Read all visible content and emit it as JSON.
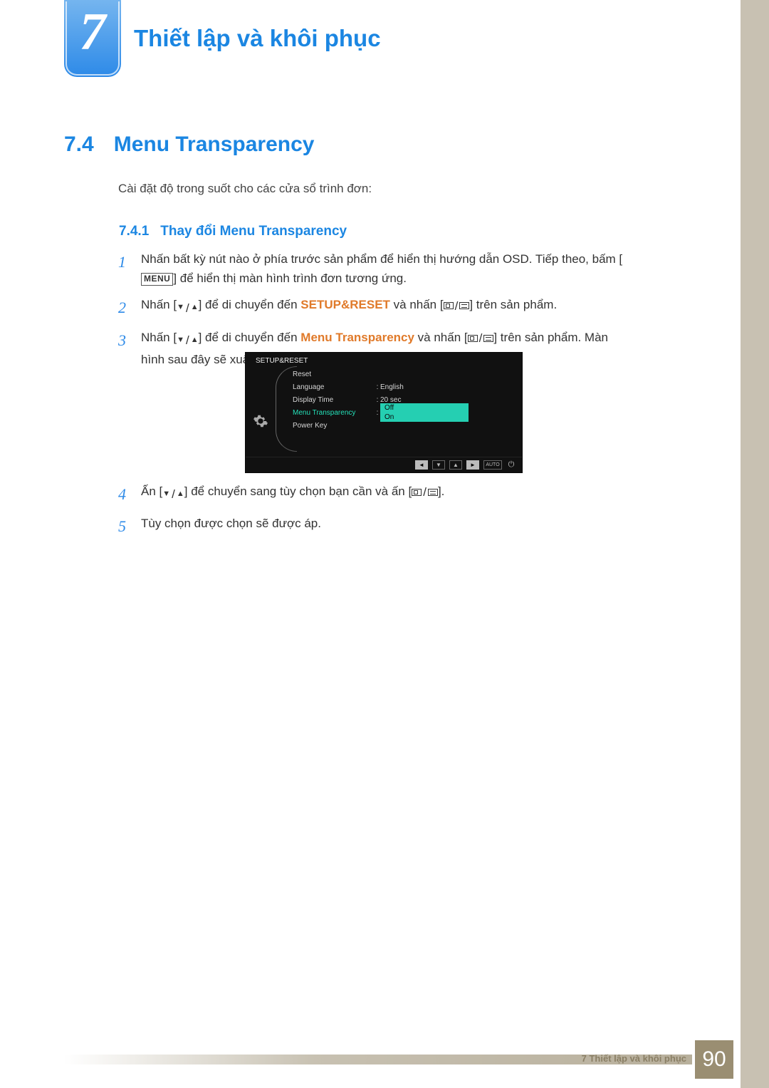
{
  "chapter": {
    "number": "7",
    "title": "Thiết lập và khôi phục"
  },
  "section": {
    "number": "7.4",
    "title": "Menu Transparency",
    "intro": "Cài đặt độ trong suốt cho các cửa sổ trình đơn:"
  },
  "subsection": {
    "number": "7.4.1",
    "title": "Thay đổi Menu Transparency"
  },
  "steps": {
    "s1_a": "Nhấn bất kỳ nút nào ở phía trước sản phẩm để hiển thị hướng dẫn OSD. Tiếp theo, bấm [",
    "s1_menu": "MENU",
    "s1_b": "] để hiển thị màn hình trình đơn tương ứng.",
    "s2_a": "Nhấn [",
    "s2_b": "] để di chuyển đến ",
    "s2_kw": "SETUP&RESET",
    "s2_c": " và nhấn [",
    "s2_d": "] trên sản phẩm.",
    "s3_a": "Nhấn [",
    "s3_b": "] để di chuyển đến ",
    "s3_kw": "Menu Transparency",
    "s3_c": " và nhấn [",
    "s3_d": "] trên sản phẩm. Màn hình sau đây sẽ xuất hiện.",
    "s4_a": "Ấn [",
    "s4_b": "] để chuyển sang tùy chọn bạn cần và ấn [",
    "s4_c": "].",
    "s5": "Tùy chọn được chọn sẽ được áp."
  },
  "osd": {
    "title": "SETUP&RESET",
    "rows": {
      "reset": "Reset",
      "language": "Language",
      "language_val": "English",
      "display_time": "Display Time",
      "display_time_val": "20 sec",
      "menu_transparency": "Menu Transparency",
      "opt_off": "Off",
      "opt_on": "On",
      "power_key": "Power Key"
    },
    "footer_auto": "AUTO"
  },
  "footer": {
    "text": "7 Thiết lập và khôi phục",
    "page": "90"
  }
}
